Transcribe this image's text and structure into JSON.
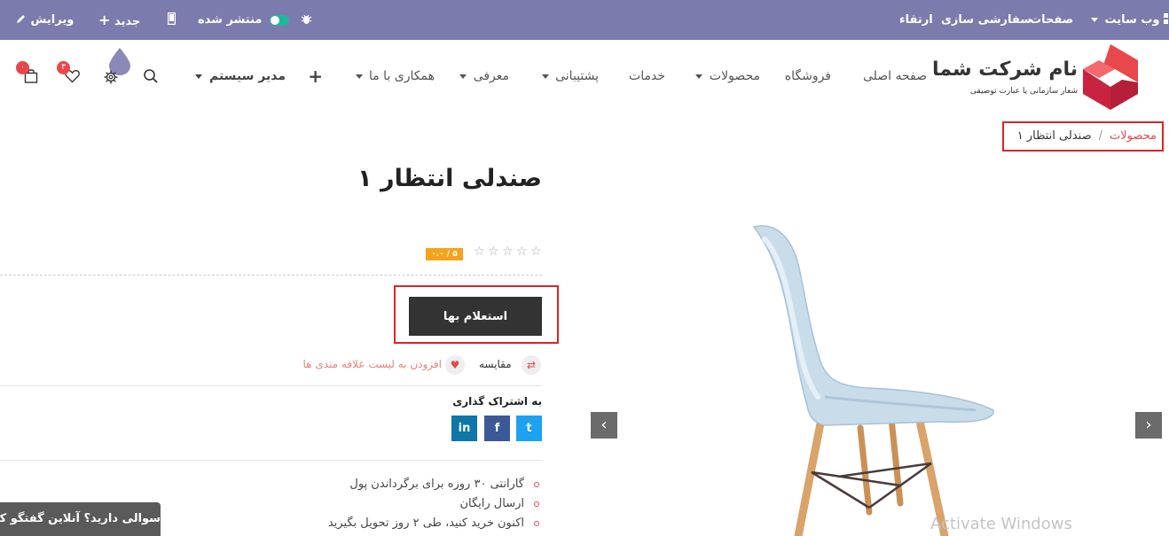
{
  "admin_bar": {
    "edit": "ویرایش",
    "new": "جدید",
    "published": "منتشر شده",
    "website": "وب سایت",
    "pages": "صفحات",
    "customize": "سفارشی سازی",
    "upgrade": "ارتقاء",
    "color": "#7c7bad"
  },
  "brand": {
    "name": "نام شرکت شما",
    "slogan": "شعار سازمانی یا عبارت توصیفی"
  },
  "nav": {
    "home": "صفحه اصلی",
    "shop": "فروشگاه",
    "products": "محصولات",
    "services": "خدمات",
    "support": "پشتیبانی",
    "intro": "معرفی",
    "cooperate": "همکاری با ما",
    "plus": "+",
    "user": "مدیر سیستم"
  },
  "badges": {
    "cart": "۰",
    "wishlist": "۳"
  },
  "breadcrumb": {
    "parent": "محصولات",
    "sep": "/",
    "current": "صندلی انتظار ۱"
  },
  "product": {
    "title": "صندلی انتظار ۱",
    "rating_badge": "۰.۰ / ۵",
    "cta": "استعلام بها",
    "compare": "مقایسه",
    "wishlist": "افزودن به لیست علاقه مندی ها",
    "share_label": "به اشتراک گذاری",
    "features": [
      "گارانتی ۳۰ روزه برای برگرداندن پول",
      "ارسال رایگان",
      "اکنون خرید کنید، طی ۲ روز تحویل بگیرید"
    ]
  },
  "social": {
    "twitter": "t",
    "facebook": "f",
    "linkedin": "in"
  },
  "chat": "سوالی دارید؟ آنلاین گفتگو کنید",
  "watermark": "Activate Windows",
  "colors": {
    "accent": "#e8474c",
    "highlight": "#d9252b",
    "chair": "#c9dcea"
  }
}
